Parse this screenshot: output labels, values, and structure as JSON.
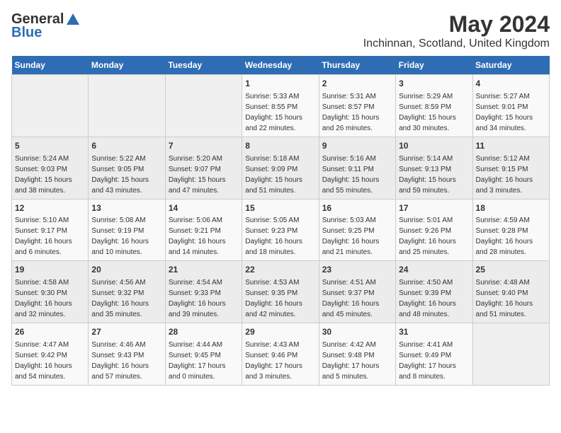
{
  "logo": {
    "general": "General",
    "blue": "Blue"
  },
  "title": {
    "month_year": "May 2024",
    "location": "Inchinnan, Scotland, United Kingdom"
  },
  "days_of_week": [
    "Sunday",
    "Monday",
    "Tuesday",
    "Wednesday",
    "Thursday",
    "Friday",
    "Saturday"
  ],
  "weeks": [
    [
      {
        "day": "",
        "content": ""
      },
      {
        "day": "",
        "content": ""
      },
      {
        "day": "",
        "content": ""
      },
      {
        "day": "1",
        "content": "Sunrise: 5:33 AM\nSunset: 8:55 PM\nDaylight: 15 hours\nand 22 minutes."
      },
      {
        "day": "2",
        "content": "Sunrise: 5:31 AM\nSunset: 8:57 PM\nDaylight: 15 hours\nand 26 minutes."
      },
      {
        "day": "3",
        "content": "Sunrise: 5:29 AM\nSunset: 8:59 PM\nDaylight: 15 hours\nand 30 minutes."
      },
      {
        "day": "4",
        "content": "Sunrise: 5:27 AM\nSunset: 9:01 PM\nDaylight: 15 hours\nand 34 minutes."
      }
    ],
    [
      {
        "day": "5",
        "content": "Sunrise: 5:24 AM\nSunset: 9:03 PM\nDaylight: 15 hours\nand 38 minutes."
      },
      {
        "day": "6",
        "content": "Sunrise: 5:22 AM\nSunset: 9:05 PM\nDaylight: 15 hours\nand 43 minutes."
      },
      {
        "day": "7",
        "content": "Sunrise: 5:20 AM\nSunset: 9:07 PM\nDaylight: 15 hours\nand 47 minutes."
      },
      {
        "day": "8",
        "content": "Sunrise: 5:18 AM\nSunset: 9:09 PM\nDaylight: 15 hours\nand 51 minutes."
      },
      {
        "day": "9",
        "content": "Sunrise: 5:16 AM\nSunset: 9:11 PM\nDaylight: 15 hours\nand 55 minutes."
      },
      {
        "day": "10",
        "content": "Sunrise: 5:14 AM\nSunset: 9:13 PM\nDaylight: 15 hours\nand 59 minutes."
      },
      {
        "day": "11",
        "content": "Sunrise: 5:12 AM\nSunset: 9:15 PM\nDaylight: 16 hours\nand 3 minutes."
      }
    ],
    [
      {
        "day": "12",
        "content": "Sunrise: 5:10 AM\nSunset: 9:17 PM\nDaylight: 16 hours\nand 6 minutes."
      },
      {
        "day": "13",
        "content": "Sunrise: 5:08 AM\nSunset: 9:19 PM\nDaylight: 16 hours\nand 10 minutes."
      },
      {
        "day": "14",
        "content": "Sunrise: 5:06 AM\nSunset: 9:21 PM\nDaylight: 16 hours\nand 14 minutes."
      },
      {
        "day": "15",
        "content": "Sunrise: 5:05 AM\nSunset: 9:23 PM\nDaylight: 16 hours\nand 18 minutes."
      },
      {
        "day": "16",
        "content": "Sunrise: 5:03 AM\nSunset: 9:25 PM\nDaylight: 16 hours\nand 21 minutes."
      },
      {
        "day": "17",
        "content": "Sunrise: 5:01 AM\nSunset: 9:26 PM\nDaylight: 16 hours\nand 25 minutes."
      },
      {
        "day": "18",
        "content": "Sunrise: 4:59 AM\nSunset: 9:28 PM\nDaylight: 16 hours\nand 28 minutes."
      }
    ],
    [
      {
        "day": "19",
        "content": "Sunrise: 4:58 AM\nSunset: 9:30 PM\nDaylight: 16 hours\nand 32 minutes."
      },
      {
        "day": "20",
        "content": "Sunrise: 4:56 AM\nSunset: 9:32 PM\nDaylight: 16 hours\nand 35 minutes."
      },
      {
        "day": "21",
        "content": "Sunrise: 4:54 AM\nSunset: 9:33 PM\nDaylight: 16 hours\nand 39 minutes."
      },
      {
        "day": "22",
        "content": "Sunrise: 4:53 AM\nSunset: 9:35 PM\nDaylight: 16 hours\nand 42 minutes."
      },
      {
        "day": "23",
        "content": "Sunrise: 4:51 AM\nSunset: 9:37 PM\nDaylight: 16 hours\nand 45 minutes."
      },
      {
        "day": "24",
        "content": "Sunrise: 4:50 AM\nSunset: 9:39 PM\nDaylight: 16 hours\nand 48 minutes."
      },
      {
        "day": "25",
        "content": "Sunrise: 4:48 AM\nSunset: 9:40 PM\nDaylight: 16 hours\nand 51 minutes."
      }
    ],
    [
      {
        "day": "26",
        "content": "Sunrise: 4:47 AM\nSunset: 9:42 PM\nDaylight: 16 hours\nand 54 minutes."
      },
      {
        "day": "27",
        "content": "Sunrise: 4:46 AM\nSunset: 9:43 PM\nDaylight: 16 hours\nand 57 minutes."
      },
      {
        "day": "28",
        "content": "Sunrise: 4:44 AM\nSunset: 9:45 PM\nDaylight: 17 hours\nand 0 minutes."
      },
      {
        "day": "29",
        "content": "Sunrise: 4:43 AM\nSunset: 9:46 PM\nDaylight: 17 hours\nand 3 minutes."
      },
      {
        "day": "30",
        "content": "Sunrise: 4:42 AM\nSunset: 9:48 PM\nDaylight: 17 hours\nand 5 minutes."
      },
      {
        "day": "31",
        "content": "Sunrise: 4:41 AM\nSunset: 9:49 PM\nDaylight: 17 hours\nand 8 minutes."
      },
      {
        "day": "",
        "content": ""
      }
    ]
  ]
}
